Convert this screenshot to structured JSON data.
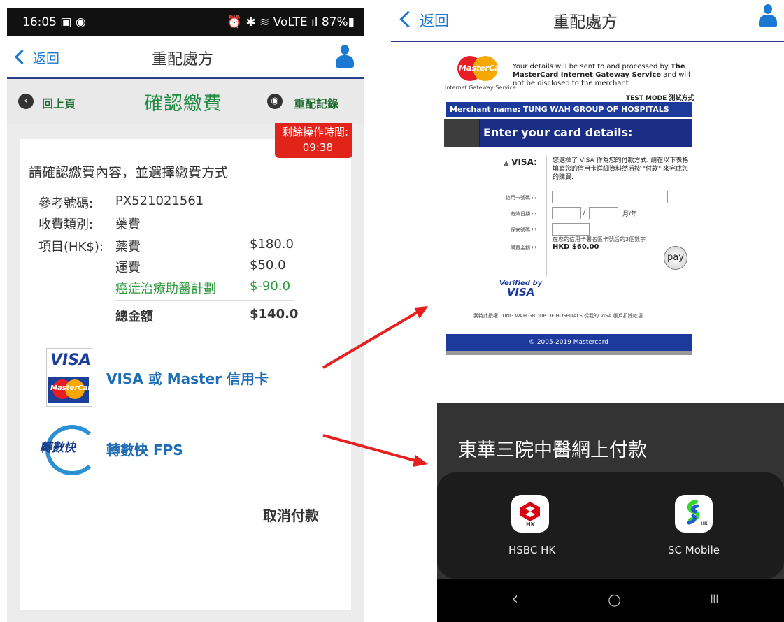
{
  "left_phone": {
    "status": {
      "time": "16:05 ▣ ◉",
      "right": "⏰ ✱ ≋ VoLTE ıl 87%▮"
    },
    "appbar": {
      "back": "返回",
      "title": "重配處方",
      "user_icon": "person-icon"
    },
    "subbar": {
      "prev": "回上頁",
      "title": "確認繳費",
      "history": "重配記錄"
    },
    "timer": {
      "label": "剩餘操作時間:",
      "value": "09:38"
    },
    "prompt": "請確認繳費內容，並選擇繳費方式",
    "details": {
      "ref_label": "參考號碼:",
      "ref_value": "PX521021561",
      "type_label": "收費類別:",
      "type_value": "藥費",
      "items_label": "項目(HK$):",
      "items": [
        {
          "name": "藥費",
          "amount": "$180.0"
        },
        {
          "name": "運費",
          "amount": "$50.0"
        },
        {
          "name": "癌症治療助醫計劃",
          "amount": "$-90.0"
        }
      ],
      "total_label": "總金額",
      "total_value": "$140.0"
    },
    "pay_options": [
      {
        "label": "VISA 或 Master 信用卡",
        "logo_visa": "VISA",
        "logo_mc": "MasterCard"
      },
      {
        "label": "轉數快 FPS",
        "logo": "轉數快"
      }
    ],
    "cancel": "取消付款"
  },
  "right_top": {
    "appbar": {
      "back": "返回",
      "title": "重配處方"
    },
    "mc_logo": "MasterCard",
    "gateway_label": "Internet Gateway Service",
    "notice_1": "Your details will be sent to and processed by ",
    "notice_bold": "The MasterCard Internet Gateway Service",
    "notice_2": " and will not be disclosed to the merchant",
    "test_mode": "TEST MODE 測試方式",
    "merchant": "Merchant name:  TUNG WAH GROUP OF HOSPITALS",
    "enter": "Enter your card details:",
    "visa_label": "VISA:",
    "visa_desc": "您選擇了 VISA 作為您的付款方式. 請在以下表格填寫您的信用卡詳細資料然后按 \"付款\" 來完成您的購買.",
    "card_no_label": "信用卡號碼 ⁝⁝⁝",
    "expiry_label": "有效日期 ⁝⁝⁝",
    "expiry_suffix": "月/年",
    "cvv_label": "保安號碼 ⁝⁝⁝",
    "cvv_hint": "在您的信用卡署名區卡號后的3個數字",
    "amount_label": "購買金額 ⁝⁝⁝",
    "amount_value": "HKD $60.00",
    "pay": "pay",
    "verified": "Verified by",
    "verified_visa": "VISA",
    "auth": "我特此授權 TUNG WAH GROUP OF HOSPITALS 從我的 VISA 帳戶扣除款項",
    "footer": "© 2005-2019 Mastercard"
  },
  "right_bottom": {
    "title": "東華三院中醫網上付款",
    "apps": [
      {
        "name": "HSBC HK",
        "icon_text": "HK"
      },
      {
        "name": "SC Mobile",
        "icon_text": "HK"
      }
    ],
    "nav": {
      "back": "‹",
      "home": "○",
      "recent": "III"
    }
  },
  "colors": {
    "accent_blue": "#1b79d4",
    "green": "#1f8a42",
    "red": "#e2231a",
    "navy": "#1b3a9c"
  }
}
